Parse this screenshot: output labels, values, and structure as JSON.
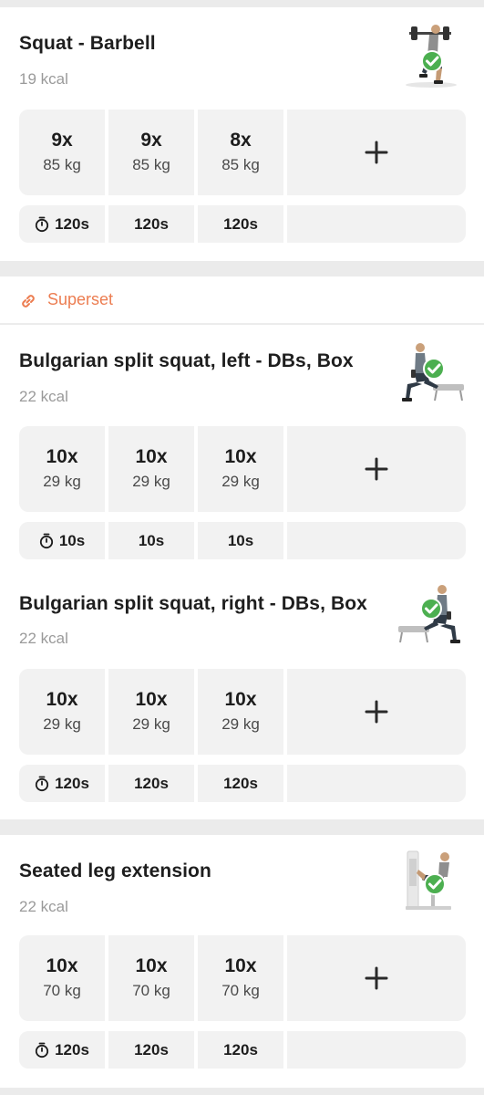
{
  "superset": {
    "label": "Superset",
    "icon": "link-icon",
    "color": "#ec7d51"
  },
  "add_icon": "plus-icon",
  "timer_icon": "stopwatch-icon",
  "exercises": [
    {
      "title": "Squat - Barbell",
      "kcal": "19 kcal",
      "thumb_icon": "squat-figure-check-icon",
      "sets": [
        {
          "reps": "9x",
          "weight": "85 kg"
        },
        {
          "reps": "9x",
          "weight": "85 kg"
        },
        {
          "reps": "8x",
          "weight": "85 kg"
        }
      ],
      "rests": [
        "120s",
        "120s",
        "120s"
      ]
    },
    {
      "title": "Bulgarian split squat, left - DBs, Box",
      "kcal": "22 kcal",
      "thumb_icon": "split-squat-figure-check-icon",
      "sets": [
        {
          "reps": "10x",
          "weight": "29 kg"
        },
        {
          "reps": "10x",
          "weight": "29 kg"
        },
        {
          "reps": "10x",
          "weight": "29 kg"
        }
      ],
      "rests": [
        "10s",
        "10s",
        "10s"
      ]
    },
    {
      "title": "Bulgarian split squat, right - DBs, Box",
      "kcal": "22 kcal",
      "thumb_icon": "split-squat-figure-check-icon",
      "sets": [
        {
          "reps": "10x",
          "weight": "29 kg"
        },
        {
          "reps": "10x",
          "weight": "29 kg"
        },
        {
          "reps": "10x",
          "weight": "29 kg"
        }
      ],
      "rests": [
        "120s",
        "120s",
        "120s"
      ]
    },
    {
      "title": "Seated leg extension",
      "kcal": "22 kcal",
      "thumb_icon": "leg-extension-figure-check-icon",
      "sets": [
        {
          "reps": "10x",
          "weight": "70 kg"
        },
        {
          "reps": "10x",
          "weight": "70 kg"
        },
        {
          "reps": "10x",
          "weight": "70 kg"
        }
      ],
      "rests": [
        "120s",
        "120s",
        "120s"
      ]
    }
  ]
}
